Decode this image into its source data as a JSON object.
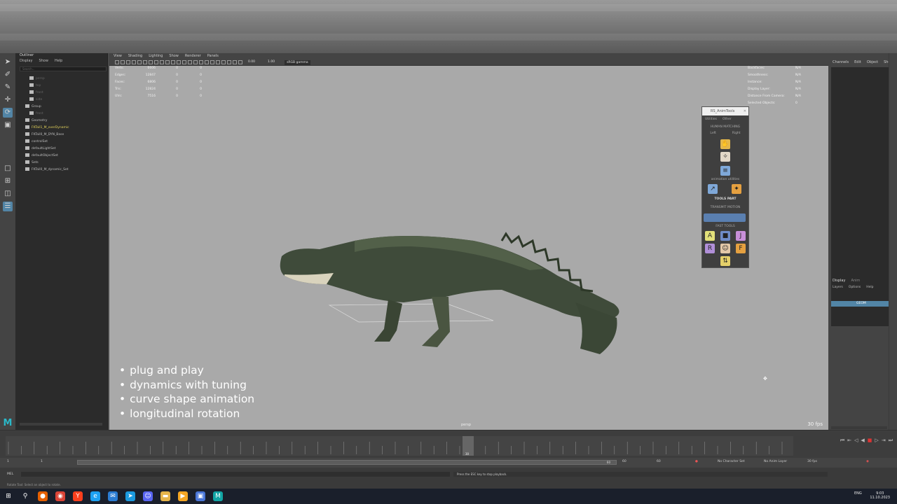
{
  "outliner": {
    "title": "Outliner",
    "menu": [
      "Display",
      "Show",
      "Help"
    ],
    "search_placeholder": "Search...",
    "items": [
      {
        "label": "persp",
        "dim": true
      },
      {
        "label": "top",
        "dim": true
      },
      {
        "label": "front",
        "dim": true
      },
      {
        "label": "side",
        "dim": true
      },
      {
        "label": "Group",
        "dim": false
      },
      {
        "label": "front",
        "dim": true
      },
      {
        "label": "Geometry",
        "dim": false
      },
      {
        "label": "FKTail1_M_overDynamic",
        "dim": false,
        "yellow": true
      },
      {
        "label": "FKTail0_M_DYN_Base",
        "dim": false
      },
      {
        "label": "controlSet",
        "dim": false
      },
      {
        "label": "defaultLightSet",
        "dim": false
      },
      {
        "label": "defaultObjectSet",
        "dim": false
      },
      {
        "label": "Sets",
        "dim": false
      },
      {
        "label": "FKTail0_M_dynamic_Set",
        "dim": false
      }
    ]
  },
  "viewport_menu": [
    "View",
    "Shading",
    "Lighting",
    "Show",
    "Renderer",
    "Panels"
  ],
  "viewport_fields": {
    "exposure": "0.00",
    "gamma": "1.00",
    "color_space": "sRGB gamma"
  },
  "hud_left": [
    {
      "label": "Verts:",
      "v1": "6606",
      "v2": "0",
      "v3": "0"
    },
    {
      "label": "Edges:",
      "v1": "12847",
      "v2": "0",
      "v3": "0"
    },
    {
      "label": "Faces:",
      "v1": "6806",
      "v2": "0",
      "v3": "0"
    },
    {
      "label": "Tris:",
      "v1": "12824",
      "v2": "0",
      "v3": "0"
    },
    {
      "label": "UVs:",
      "v1": "7516",
      "v2": "0",
      "v3": "0"
    }
  ],
  "hud_right": [
    {
      "label": "Backfaces:",
      "value": "N/A"
    },
    {
      "label": "Smoothness:",
      "value": "N/A"
    },
    {
      "label": "Instance:",
      "value": "N/A"
    },
    {
      "label": "Display Layer:",
      "value": "N/A"
    },
    {
      "label": "Distance From Camera:",
      "value": "N/A"
    },
    {
      "label": "Selected Objects:",
      "value": "0"
    }
  ],
  "bullets": [
    "plug and play",
    "dynamics with tuning",
    "curve shape animation",
    "longitudinal rotation"
  ],
  "camera": "persp",
  "fps": "30 fps",
  "toolwin": {
    "title": "RS_AnimTools",
    "menu": [
      "Utilities",
      "Other"
    ],
    "human_matching": "HUMAN MATCHING",
    "left": "Left",
    "right": "Right",
    "animation_utilities": "animation utilities",
    "tools_part": "TOOLS PART",
    "transmit_motion": "TRANSMIT MOTION",
    "fast_tools": "FAST TOOLS"
  },
  "right_panel": {
    "tabs": [
      "Channels",
      "Edit",
      "Object",
      "Show"
    ],
    "display_tabs": [
      "Display",
      "Anim"
    ],
    "display_menu": [
      "Layers",
      "Options",
      "Help"
    ],
    "layer": "GEOM"
  },
  "timeline": {
    "current_frame": "30"
  },
  "range": {
    "start": "1",
    "inner_start": "1",
    "inner_end": "60",
    "end": "60",
    "playback_end": "60"
  },
  "status": {
    "character_set": "No Character Set",
    "anim_layer": "No Anim Layer",
    "fps": "30 fps"
  },
  "command": {
    "language": "MEL",
    "result": "Press the ESC key to stop playback.",
    "help": "Rotate Tool: Select an object to rotate."
  },
  "tray": {
    "lang": "ENG",
    "time": "9:03",
    "date": "11.10.2023"
  }
}
